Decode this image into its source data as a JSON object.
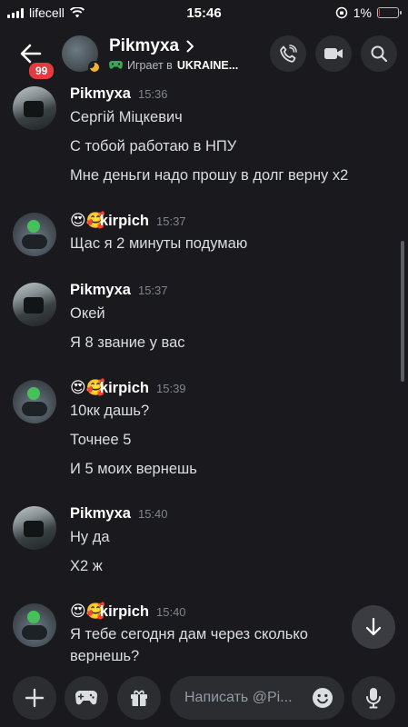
{
  "status_bar": {
    "carrier": "lifecell",
    "time": "15:46",
    "battery": "1%",
    "battery_level": 0.01
  },
  "header": {
    "unread_badge": "99",
    "name": "Pikmyxa",
    "activity_prefix": "Играет в",
    "activity_game": "UKRAINE..."
  },
  "messages": [
    {
      "author": "Pikmyxa",
      "time": "15:36",
      "lines": [
        "Сергій Міцкевич",
        "С тобой работаю в НПУ",
        "Мне деньги надо прошу в долг верну х2"
      ]
    },
    {
      "author": "kirpich",
      "emojis": "😍🥰",
      "time": "15:37",
      "lines": [
        "Щас я 2 минуты подумаю"
      ]
    },
    {
      "author": "Pikmyxa",
      "time": "15:37",
      "lines": [
        "Окей",
        "Я 8 звание у вас"
      ]
    },
    {
      "author": "kirpich",
      "emojis": "😍🥰",
      "time": "15:39",
      "lines": [
        "10кк дашь?",
        "Точнее 5",
        "И 5 моих вернешь"
      ]
    },
    {
      "author": "Pikmyxa",
      "time": "15:40",
      "lines": [
        "Ну да",
        "Х2 ж"
      ]
    },
    {
      "author": "kirpich",
      "emojis": "😍🥰",
      "time": "15:40",
      "lines": [
        "Я тебе сегодня дам через сколько",
        "вернешь?"
      ]
    }
  ],
  "composer": {
    "placeholder": "Написать @Pi..."
  },
  "icons": {
    "back": "arrow-left-icon",
    "call": "phone-icon",
    "video": "video-camera-icon",
    "search": "search-icon",
    "add": "plus-icon",
    "games": "gamepad-icon",
    "gift": "gift-icon",
    "emoji": "emoji-icon",
    "mic": "microphone-icon",
    "jump": "arrow-down-icon"
  }
}
